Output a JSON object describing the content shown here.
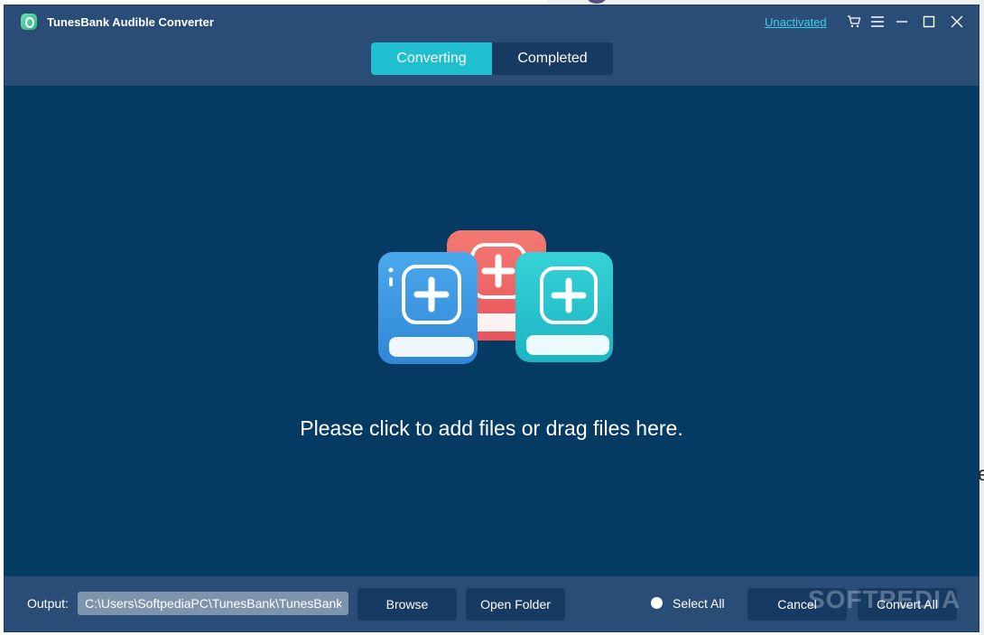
{
  "app": {
    "title": "TunesBank Audible Converter",
    "activation_link": "Unactivated"
  },
  "titlebar_icons": [
    "cart-icon",
    "menu-icon",
    "minimize-icon",
    "maximize-icon",
    "close-icon"
  ],
  "tabs": [
    {
      "label": "Converting",
      "active": true
    },
    {
      "label": "Completed",
      "active": false
    }
  ],
  "main": {
    "drop_hint": "Please click to add files or drag files here."
  },
  "footer": {
    "output_label": "Output:",
    "output_path": "C:\\Users\\SoftpediaPC\\TunesBank\\TunesBank",
    "browse_label": "Browse",
    "open_folder_label": "Open Folder",
    "select_all_label": "Select All",
    "cancel_label": "Cancel",
    "convert_all_label": "Convert All"
  },
  "watermark": "SOFTPEDIA",
  "colors": {
    "window_bg": "#2a4d77",
    "content_bg": "#053a63",
    "accent": "#1fbfd0",
    "link": "#3fd0e8",
    "button_bg": "#173a63",
    "book_blue": "#3d9be0",
    "book_red": "#ee5f63",
    "book_teal": "#26c3cc"
  }
}
